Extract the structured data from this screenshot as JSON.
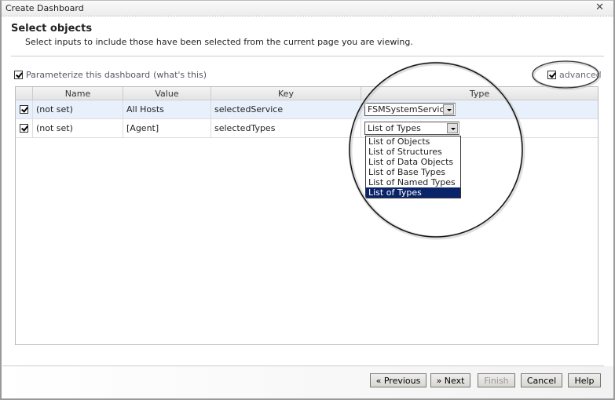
{
  "window": {
    "title": "Create Dashboard",
    "close_icon": "close-icon"
  },
  "header": {
    "title": "Select objects",
    "subtitle": "Select inputs to include those have been selected from the current page you are viewing."
  },
  "options": {
    "parameterize_label": "Parameterize this dashboard",
    "whats_this": "(what's this)",
    "parameterize_checked": true,
    "advanced_label": "advanced",
    "advanced_checked": true
  },
  "table": {
    "columns": [
      "Name",
      "Value",
      "Key",
      "Type"
    ],
    "rows": [
      {
        "checked": true,
        "name": "(not set)",
        "value": "All Hosts",
        "key": "selectedService",
        "type": "FSMSystemService"
      },
      {
        "checked": true,
        "name": "(not set)",
        "value": "[Agent]",
        "key": "selectedTypes",
        "type": "List of Types"
      }
    ]
  },
  "dropdown": {
    "options": [
      "List of Objects",
      "List of Structures",
      "List of Data Objects",
      "List of Base Types",
      "List of Named Types",
      "List of Types"
    ],
    "selected": "List of Types",
    "highlight_color": "#0a246a"
  },
  "buttons": {
    "previous": "« Previous",
    "next": "» Next",
    "finish": "Finish",
    "cancel": "Cancel",
    "help": "Help"
  }
}
